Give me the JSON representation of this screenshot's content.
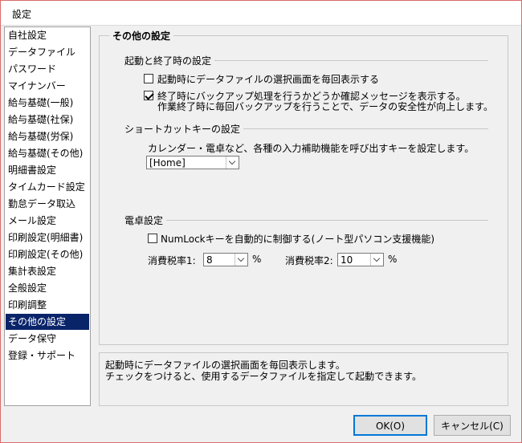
{
  "window": {
    "title": "設定"
  },
  "sidebar": {
    "items": [
      {
        "label": "自社設定"
      },
      {
        "label": "データファイル"
      },
      {
        "label": "パスワード"
      },
      {
        "label": "マイナンバー"
      },
      {
        "label": "給与基礎(一般)"
      },
      {
        "label": "給与基礎(社保)"
      },
      {
        "label": "給与基礎(労保)"
      },
      {
        "label": "給与基礎(その他)"
      },
      {
        "label": "明細書設定"
      },
      {
        "label": "タイムカード設定"
      },
      {
        "label": "勤怠データ取込"
      },
      {
        "label": "メール設定"
      },
      {
        "label": "印刷設定(明細書)"
      },
      {
        "label": "印刷設定(その他)"
      },
      {
        "label": "集計表設定"
      },
      {
        "label": "全般設定"
      },
      {
        "label": "印刷調整"
      },
      {
        "label": "その他の設定"
      },
      {
        "label": "データ保守"
      },
      {
        "label": "登録・サポート"
      }
    ],
    "selected_label": "その他の設定"
  },
  "panel": {
    "title": "その他の設定",
    "startup": {
      "heading": "起動と終了時の設定",
      "show_file_select": {
        "label": "起動時にデータファイルの選択画面を毎回表示する",
        "checked": false
      },
      "backup_confirm": {
        "label": "終了時にバックアップ処理を行うかどうか確認メッセージを表示する。",
        "note": "作業終了時に毎回バックアップを行うことで、データの安全性が向上します。",
        "checked": true
      }
    },
    "shortcut": {
      "heading": "ショートカットキーの設定",
      "description": "カレンダー・電卓など、各種の入力補助機能を呼び出すキーを設定します。",
      "key_value": "[Home]"
    },
    "calculator": {
      "heading": "電卓設定",
      "numlock": {
        "label": "NumLockキーを自動的に制御する(ノート型パソコン支援機能)",
        "checked": false
      },
      "tax1": {
        "label": "消費税率1:",
        "value": "8",
        "unit": "%"
      },
      "tax2": {
        "label": "消費税率2:",
        "value": "10",
        "unit": "%"
      }
    }
  },
  "description": {
    "line1": "起動時にデータファイルの選択画面を毎回表示します。",
    "line2": "チェックをつけると、使用するデータファイルを指定して起動できます。"
  },
  "buttons": {
    "ok": "OK(O)",
    "cancel": "キャンセル(C)"
  }
}
